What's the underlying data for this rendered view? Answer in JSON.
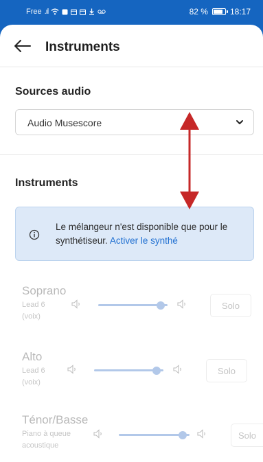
{
  "status_bar": {
    "carrier": "Free",
    "signal_icons": ".ıl",
    "battery_text": "82 %",
    "time": "18:17",
    "battery_level_percent": 82
  },
  "header": {
    "title": "Instruments",
    "back_icon": "arrow-left-icon"
  },
  "audio_sources": {
    "section_title": "Sources audio",
    "selected_value": "Audio Musescore"
  },
  "instruments_section": {
    "section_title": "Instruments",
    "info": {
      "text": "Le mélangeur n'est disponible que pour le synthétiseur.",
      "link_text": "Activer le synthé"
    },
    "items": [
      {
        "name": "Soprano",
        "sub_line1": "Lead 6",
        "sub_line2": "(voix)",
        "volume": 0.9,
        "solo_label": "Solo"
      },
      {
        "name": "Alto",
        "sub_line1": "Lead 6",
        "sub_line2": "(voix)",
        "volume": 0.9,
        "solo_label": "Solo"
      },
      {
        "name": "Ténor/Basse",
        "sub_line1": "Piano à queue",
        "sub_line2": "acoustique",
        "volume": 0.9,
        "solo_label": "Solo"
      }
    ]
  },
  "colors": {
    "accent": "#1565c0",
    "annotation_arrow": "#c62828",
    "info_background": "#dde9f8",
    "link": "#1f6fd1"
  }
}
